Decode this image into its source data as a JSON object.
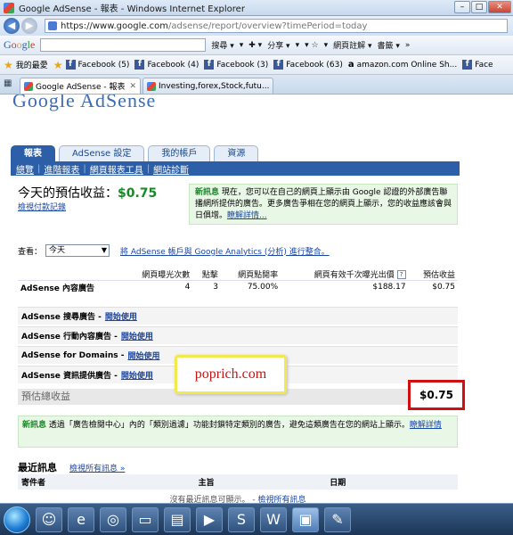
{
  "window": {
    "title": "Google AdSense - 報表 - Windows Internet Explorer"
  },
  "address": {
    "domain": "https://www.google.com",
    "path": "/adsense/report/overview?timePeriod=today"
  },
  "toolbar": {
    "logo_letters": [
      "G",
      "o",
      "o",
      "g",
      "l",
      "e"
    ],
    "tools": [
      "搜尋 ▾",
      "▾",
      "✚ ▾",
      "分享 ▾",
      "▾",
      "▾ ☆",
      "▾",
      "網頁註解 ▾",
      "書籤 ▾",
      "»"
    ]
  },
  "favorites": {
    "label": "我的最愛",
    "items": [
      "Facebook (5)",
      "Facebook (4)",
      "Facebook (3)",
      "Facebook (63)",
      "amazon.com Online Sh...",
      "Face"
    ]
  },
  "tabs": [
    {
      "label": "Google AdSense - 報表"
    },
    {
      "label": "Investing,forex,Stock,futu..."
    }
  ],
  "page": {
    "logo": "Google AdSense",
    "nav_tabs": [
      "報表",
      "AdSense 設定",
      "我的帳戶",
      "資源"
    ],
    "sub_nav": [
      "總覽",
      "進階報表",
      "網頁報表工具",
      "網站診斷"
    ],
    "today_label": "今天的預估收益：",
    "today_value": "$0.75",
    "history_link": "檢視付款記錄",
    "notice": {
      "title": "新訊息",
      "text": "現在，您可以在自己的網頁上顯示由 Google 認證的外部廣告聯播網所提供的廣告。更多廣告爭相在您的網頁上顯示，您的收益應該會與日俱增。",
      "link": "瞭解詳情..."
    },
    "view_label": "查看：",
    "view_select": "今天",
    "ga_link": "將 AdSense 帳戶與 Google Analytics (分析) 進行整合。",
    "report_headers": [
      "網頁曝光次數",
      "點擊",
      "網頁點閱率",
      "網頁有效千次曝光出價",
      "預估收益"
    ],
    "help_icon": "?",
    "content_row": {
      "name": "AdSense 內容廣告",
      "impressions": "4",
      "clicks": "3",
      "ctr": "75.00%",
      "rpm": "$188.17",
      "earnings": "$0.75"
    },
    "products": [
      {
        "name": "AdSense 搜尋廣告 -",
        "link": "開始使用"
      },
      {
        "name": "AdSense 行動內容廣告 -",
        "link": "開始使用"
      },
      {
        "name": "AdSense for Domains -",
        "link": "開始使用"
      },
      {
        "name": "AdSense 資訊提供廣告 -",
        "link": "開始使用"
      }
    ],
    "total_label": "預估總收益",
    "total_value": "$0.75",
    "watermark": "poprich.com",
    "notice2": {
      "title": "新訊息",
      "text": "透過「廣告檢閱中心」內的「類別過濾」功能封鎖特定類別的廣告，避免這類廣告在您的網站上顯示。",
      "link": "瞭解詳情"
    },
    "recent_title": "最近訊息",
    "recent_link": "檢視所有訊息 »",
    "msg_headers": [
      "寄件者",
      "主旨",
      "日期"
    ],
    "msg_empty": "沒有最近訊息可顯示。 -",
    "msg_empty_link": "檢視所有訊息"
  }
}
